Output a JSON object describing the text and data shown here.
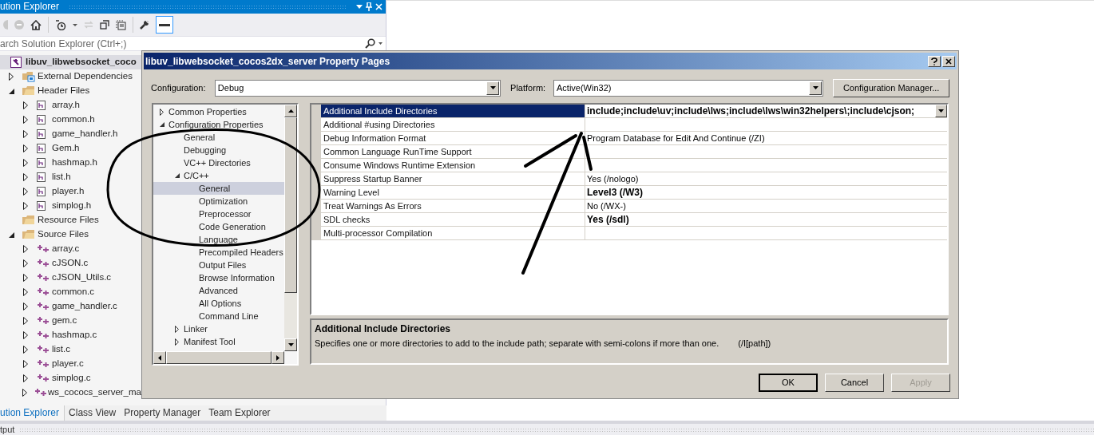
{
  "solution_explorer": {
    "title": "ution Explorer",
    "search": {
      "placeholder": "arch Solution Explorer (Ctrl+;)"
    },
    "tree": [
      {
        "kind": "project",
        "label": "libuv_libwebsocket_coco",
        "selected": true,
        "children": [
          {
            "kind": "external",
            "label": "External Dependencies",
            "expanded": false,
            "selected": false
          },
          {
            "kind": "folder",
            "label": "Header Files",
            "expanded": true,
            "selected": false,
            "children": [
              {
                "kind": "header",
                "label": "array.h",
                "expanded": false,
                "selected": false
              },
              {
                "kind": "header",
                "label": "common.h",
                "expanded": false,
                "selected": false
              },
              {
                "kind": "header",
                "label": "game_handler.h",
                "expanded": false,
                "selected": false
              },
              {
                "kind": "header",
                "label": "Gem.h",
                "expanded": false,
                "selected": false
              },
              {
                "kind": "header",
                "label": "hashmap.h",
                "expanded": false,
                "selected": false
              },
              {
                "kind": "header",
                "label": "list.h",
                "expanded": false,
                "selected": false
              },
              {
                "kind": "header",
                "label": "player.h",
                "expanded": false,
                "selected": false
              },
              {
                "kind": "header",
                "label": "simplog.h",
                "expanded": false,
                "selected": false
              }
            ]
          },
          {
            "kind": "folder",
            "label": "Resource Files",
            "selected": false
          },
          {
            "kind": "folder",
            "label": "Source Files",
            "expanded": true,
            "selected": false,
            "children": [
              {
                "kind": "source",
                "label": "array.c",
                "expanded": false,
                "selected": false
              },
              {
                "kind": "source",
                "label": "cJSON.c",
                "expanded": false,
                "selected": false
              },
              {
                "kind": "source",
                "label": "cJSON_Utils.c",
                "expanded": false,
                "selected": false
              },
              {
                "kind": "source",
                "label": "common.c",
                "expanded": false,
                "selected": false
              },
              {
                "kind": "source",
                "label": "game_handler.c",
                "expanded": false,
                "selected": false
              },
              {
                "kind": "source",
                "label": "gem.c",
                "expanded": false,
                "selected": false
              },
              {
                "kind": "source",
                "label": "hashmap.c",
                "expanded": false,
                "selected": false
              },
              {
                "kind": "source",
                "label": "list.c",
                "expanded": false,
                "selected": false
              },
              {
                "kind": "source",
                "label": "player.c",
                "expanded": false,
                "selected": false
              },
              {
                "kind": "source",
                "label": "simplog.c",
                "expanded": false,
                "selected": false
              },
              {
                "kind": "source",
                "label": "ws_cococs_server_ma",
                "expanded": false,
                "selected": false
              }
            ]
          }
        ]
      }
    ],
    "tabs": [
      {
        "label": "ution Explorer",
        "selected": true
      },
      {
        "label": "Class View",
        "selected": false
      },
      {
        "label": "Property Manager",
        "selected": false
      },
      {
        "label": "Team Explorer",
        "selected": false
      }
    ]
  },
  "output_panel": {
    "title": "tput"
  },
  "dialog": {
    "title": "libuv_libwebsocket_cocos2dx_server Property Pages",
    "configuration": {
      "label": "Configuration:",
      "value": "Debug"
    },
    "platform": {
      "label": "Platform:",
      "value": "Active(Win32)"
    },
    "configuration_manager_button": "Configuration Manager...",
    "category_tree": [
      {
        "label": "Common Properties",
        "expanded": false,
        "selected": false
      },
      {
        "label": "Configuration Properties",
        "expanded": true,
        "selected": false,
        "children": [
          {
            "label": "General",
            "selected": false
          },
          {
            "label": "Debugging",
            "selected": false
          },
          {
            "label": "VC++ Directories",
            "selected": false
          },
          {
            "label": "C/C++",
            "expanded": true,
            "selected": false,
            "children": [
              {
                "label": "General",
                "selected": true
              },
              {
                "label": "Optimization",
                "selected": false
              },
              {
                "label": "Preprocessor",
                "selected": false
              },
              {
                "label": "Code Generation",
                "selected": false
              },
              {
                "label": "Language",
                "selected": false
              },
              {
                "label": "Precompiled Headers",
                "selected": false
              },
              {
                "label": "Output Files",
                "selected": false
              },
              {
                "label": "Browse Information",
                "selected": false
              },
              {
                "label": "Advanced",
                "selected": false
              },
              {
                "label": "All Options",
                "selected": false
              },
              {
                "label": "Command Line",
                "selected": false
              }
            ]
          },
          {
            "label": "Linker",
            "expanded": false,
            "selected": false
          },
          {
            "label": "Manifest Tool",
            "expanded": false,
            "selected": false
          }
        ]
      }
    ],
    "properties": [
      {
        "name": "Additional Include Directories",
        "value": "include;include\\uv;include\\lws;include\\lws\\win32helpers\\;include\\cjson;",
        "bold": true,
        "selected": true
      },
      {
        "name": "Additional #using Directories",
        "selected": false
      },
      {
        "name": "Debug Information Format",
        "value": "Program Database for Edit And Continue (/ZI)",
        "bold": false,
        "selected": false
      },
      {
        "name": "Common Language RunTime Support",
        "selected": false
      },
      {
        "name": "Consume Windows Runtime Extension",
        "selected": false
      },
      {
        "name": "Suppress Startup Banner",
        "value": "Yes (/nologo)",
        "bold": false,
        "selected": false
      },
      {
        "name": "Warning Level",
        "value": "Level3 (/W3)",
        "bold": true,
        "selected": false
      },
      {
        "name": "Treat Warnings As Errors",
        "value": "No (/WX-)",
        "bold": false,
        "selected": false
      },
      {
        "name": "SDL checks",
        "value": "Yes (/sdl)",
        "bold": true,
        "selected": false
      },
      {
        "name": "Multi-processor Compilation",
        "selected": false
      }
    ],
    "description": {
      "title": "Additional Include Directories",
      "text": "Specifies one or more directories to add to the include path; separate with semi-colons if more than one.",
      "switch": "(/I[path])"
    },
    "buttons": [
      {
        "label": "OK",
        "default": true,
        "disabled": false
      },
      {
        "label": "Cancel",
        "default": false,
        "disabled": false
      },
      {
        "label": "Apply",
        "default": false,
        "disabled": true
      }
    ]
  }
}
